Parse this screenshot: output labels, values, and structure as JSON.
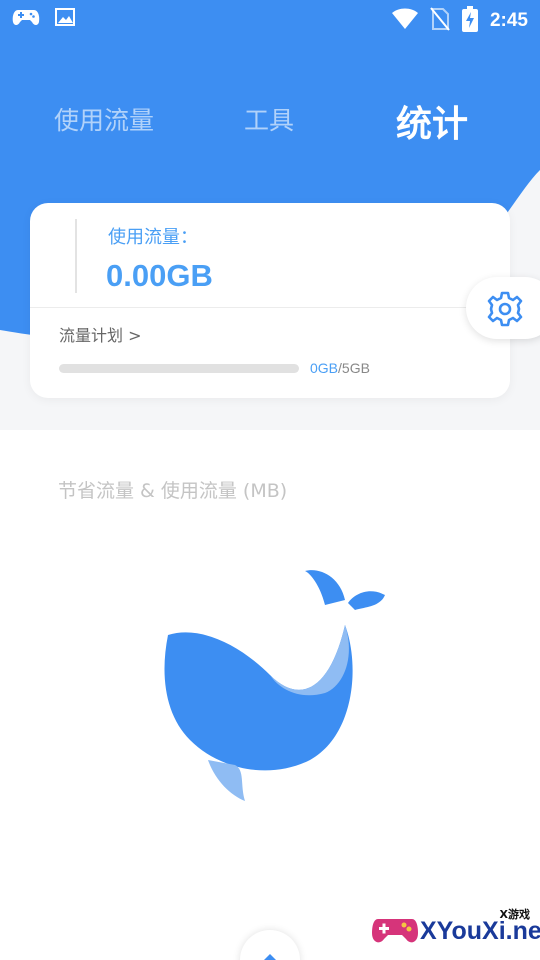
{
  "status_bar": {
    "time": "2:45",
    "icons": [
      "gamepad-icon",
      "image-icon",
      "wifi-icon",
      "no-sim-icon",
      "battery-charging-icon"
    ]
  },
  "tabs": [
    {
      "label": "使用流量",
      "active": false
    },
    {
      "label": "工具",
      "active": false
    },
    {
      "label": "统计",
      "active": true
    }
  ],
  "usage_card": {
    "label": "使用流量：",
    "value": "0.00GB",
    "plan_link": "流量计划 >",
    "quota_used": "0GB",
    "quota_total": "/5GB",
    "progress_fraction": 0
  },
  "chart_section": {
    "title": "节省流量 & 使用流量 (MB)"
  },
  "watermark": {
    "small": "X游戏",
    "main": "XYouXi.net"
  },
  "colors": {
    "primary": "#3d8ef2",
    "accent_text": "#4a9ff5",
    "background": "#f5f6f8"
  }
}
